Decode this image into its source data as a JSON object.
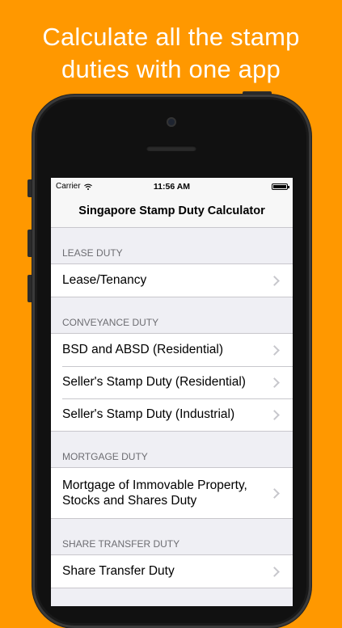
{
  "promo": {
    "line1": "Calculate all the stamp",
    "line2": "duties with one app"
  },
  "status_bar": {
    "carrier": "Carrier",
    "time": "11:56 AM"
  },
  "nav": {
    "title": "Singapore Stamp Duty Calculator"
  },
  "sections": [
    {
      "header": "LEASE DUTY",
      "items": [
        "Lease/Tenancy"
      ]
    },
    {
      "header": "CONVEYANCE DUTY",
      "items": [
        "BSD and ABSD (Residential)",
        "Seller's Stamp Duty (Residential)",
        "Seller's Stamp Duty (Industrial)"
      ]
    },
    {
      "header": "MORTGAGE DUTY",
      "items": [
        "Mortgage of Immovable Property,\nStocks and Shares Duty"
      ]
    },
    {
      "header": "SHARE TRANSFER DUTY",
      "items": [
        "Share Transfer Duty"
      ]
    }
  ],
  "colors": {
    "background": "#ff9800",
    "screen_bg": "#efeff4",
    "separator": "#c8c7cc",
    "header_text": "#6d6d72",
    "chevron": "#c7c7cc"
  },
  "icons": {
    "cell_disclosure": "chevron-right-icon",
    "wifi": "wifi-icon",
    "battery": "battery-icon"
  }
}
